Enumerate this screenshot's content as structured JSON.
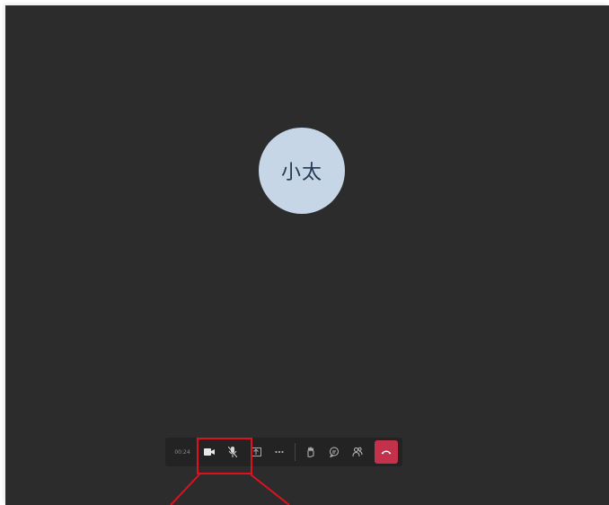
{
  "call": {
    "participant_initials": "小太",
    "timer": "00:24"
  },
  "toolbar": {
    "buttons": [
      {
        "name": "camera",
        "icon": "video-camera-icon"
      },
      {
        "name": "microphone",
        "icon": "microphone-muted-icon"
      },
      {
        "name": "share",
        "icon": "share-tray-icon"
      },
      {
        "name": "more",
        "icon": "more-actions-icon"
      },
      {
        "name": "raise-hand",
        "icon": "raise-hand-icon"
      },
      {
        "name": "chat",
        "icon": "chat-icon"
      },
      {
        "name": "participants",
        "icon": "people-icon"
      },
      {
        "name": "hang-up",
        "icon": "hang-up-icon"
      }
    ]
  },
  "colors": {
    "background": "#2c2c2c",
    "avatar": "#c6d6e6",
    "hangup": "#c4314b",
    "annotation": "#e01020"
  }
}
